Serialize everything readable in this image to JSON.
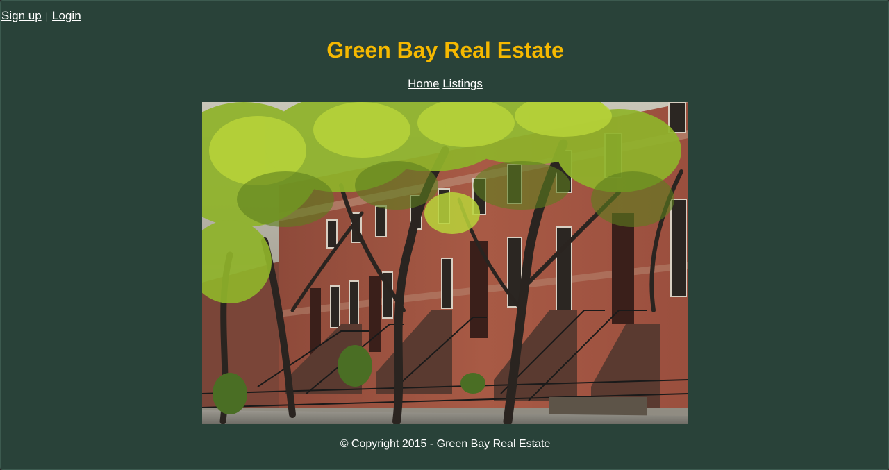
{
  "auth": {
    "signup_label": "Sign up",
    "separator": "|",
    "login_label": "Login"
  },
  "site": {
    "title": "Green Bay Real Estate"
  },
  "nav": {
    "home_label": "Home",
    "listings_label": "Listings"
  },
  "footer": {
    "copyright": "© Copyright 2015 - Green Bay Real Estate"
  },
  "colors": {
    "background": "#294239",
    "title": "#f5b800",
    "link": "#ffffff"
  }
}
